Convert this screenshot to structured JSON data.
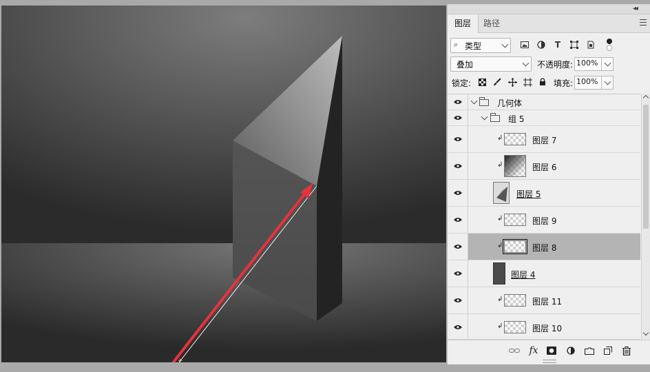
{
  "panel": {
    "collapse_glyph": "◂◂",
    "close_glyph": "✕",
    "tabs": [
      {
        "label": "图层",
        "active": true
      },
      {
        "label": "路径",
        "active": false
      }
    ],
    "menu_icon": "hamburger-icon"
  },
  "filter": {
    "kind_label": "类型",
    "icons": [
      "image-filter-icon",
      "adjustment-filter-icon",
      "type-filter-icon",
      "shape-filter-icon",
      "smart-object-filter-icon",
      "filter-toggle-icon"
    ]
  },
  "blend": {
    "mode": "叠加",
    "opacity_label": "不透明度:",
    "opacity_value": "100%"
  },
  "lock": {
    "label": "锁定:",
    "icons": [
      "lock-transparent-pixels-icon",
      "lock-image-pixels-icon",
      "lock-position-icon",
      "lock-artboard-icon",
      "lock-all-icon"
    ],
    "fill_label": "填充:",
    "fill_value": "100%"
  },
  "layers": [
    {
      "name": "几何体",
      "kind": "group",
      "level": 0,
      "expanded": true,
      "visible": true
    },
    {
      "name": "组 5",
      "kind": "group",
      "level": 1,
      "expanded": true,
      "visible": true
    },
    {
      "name": "图层 7",
      "kind": "layer",
      "clipped": true,
      "thumb": "transparent",
      "visible": true
    },
    {
      "name": "图层 6",
      "kind": "layer",
      "clipped": true,
      "thumb": "gradient",
      "visible": true
    },
    {
      "name": "图层 5",
      "kind": "layer",
      "clipped": false,
      "thumb": "triangle",
      "underlined": true,
      "visible": true
    },
    {
      "name": "图层 9",
      "kind": "layer",
      "clipped": true,
      "thumb": "transparent",
      "visible": true
    },
    {
      "name": "图层 8",
      "kind": "layer",
      "clipped": true,
      "thumb": "transparent",
      "selected": true,
      "visible": true
    },
    {
      "name": "图层 4",
      "kind": "layer",
      "clipped": false,
      "thumb": "dark-bar",
      "underlined": true,
      "visible": true
    },
    {
      "name": "图层 11",
      "kind": "layer",
      "clipped": true,
      "thumb": "transparent",
      "visible": true
    },
    {
      "name": "图层 10",
      "kind": "layer",
      "clipped": true,
      "thumb": "transparent",
      "visible": true
    }
  ],
  "bottom_bar": {
    "fx_label": "fx",
    "icons": [
      "link-layers-icon",
      "layer-style-icon",
      "add-mask-icon",
      "new-adjustment-layer-icon",
      "new-group-icon",
      "new-layer-icon",
      "delete-layer-icon"
    ]
  },
  "colors": {
    "annotation_arrow": "#e8323a",
    "selected_row": "#b4b4b4",
    "panel_bg": "#efefef"
  }
}
